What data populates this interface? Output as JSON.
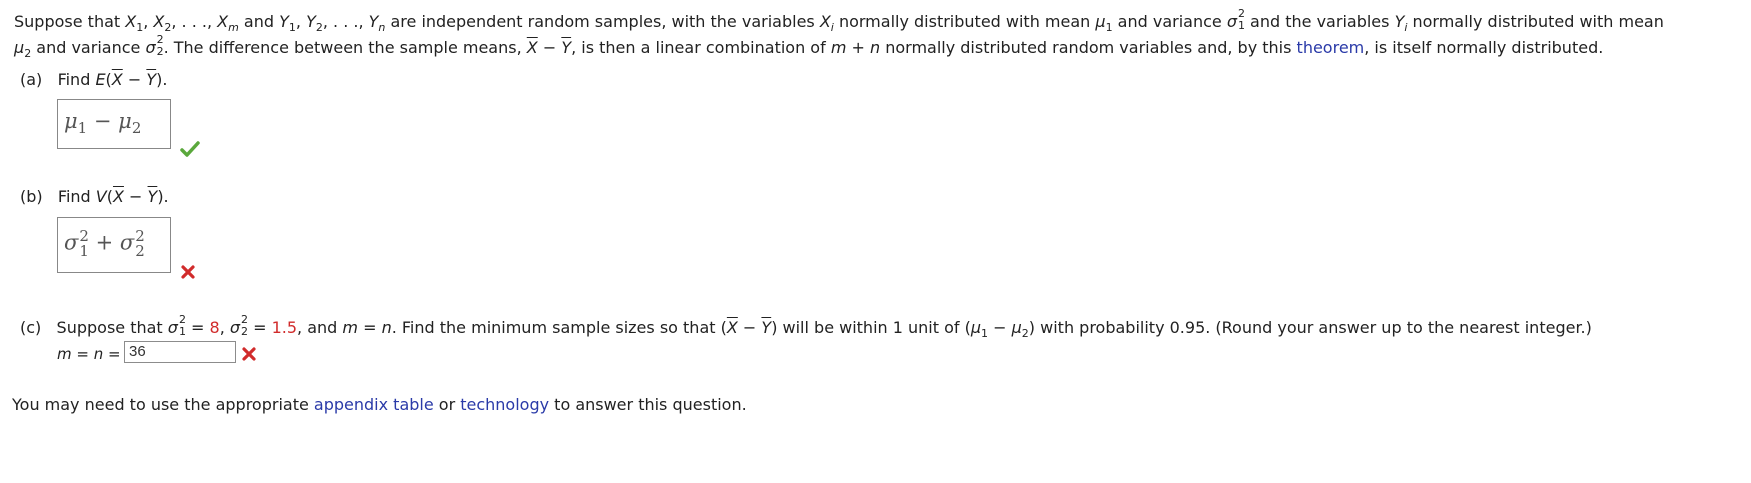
{
  "problem": {
    "t1": "Suppose that ",
    "t2": " and ",
    "t3": " are independent random samples, with the variables ",
    "t4": " normally distributed with mean ",
    "t5": " and variance ",
    "t6": " and the variables ",
    "t7": " normally distributed with mean",
    "t8": " and variance ",
    "t9": ". The difference between the sample means, ",
    "t10": ", is then a linear combination of ",
    "t11": " normally distributed random variables and, by this ",
    "theorem_link": "theorem",
    "t12": ", is itself normally distributed."
  },
  "part_a": {
    "label": "(a)",
    "prompt_prefix": "Find ",
    "prompt_expr": "E(X − Y).",
    "answer_display": "μ1 − μ2",
    "status": "correct"
  },
  "part_b": {
    "label": "(b)",
    "prompt_prefix": "Find ",
    "prompt_expr": "V(X − Y).",
    "answer_display": "σ1² + σ2²",
    "status": "incorrect"
  },
  "part_c": {
    "label": "(c)",
    "sigma1_sq_value": "8",
    "sigma2_sq_value": "1.5",
    "text_a": "Suppose that ",
    "text_b": ", and ",
    "text_c": ". Find the minimum sample sizes so that ",
    "text_d": " will be within 1 unit of ",
    "text_e": " with probability 0.95. (Round your answer up to the nearest integer.)",
    "input_label": "m = n =",
    "input_value": "36",
    "status": "incorrect"
  },
  "footer": {
    "prefix": "You may need to use the appropriate ",
    "link1": "appendix table",
    "middle": " or ",
    "link2": "technology",
    "suffix": " to answer this question."
  },
  "colors": {
    "link": "#2a3aa8",
    "check": "#5aa83c",
    "cross": "#d12b2b",
    "given": "#d12b2b"
  },
  "icons": {
    "correct": "checkmark-icon",
    "incorrect": "x-mark-icon"
  }
}
